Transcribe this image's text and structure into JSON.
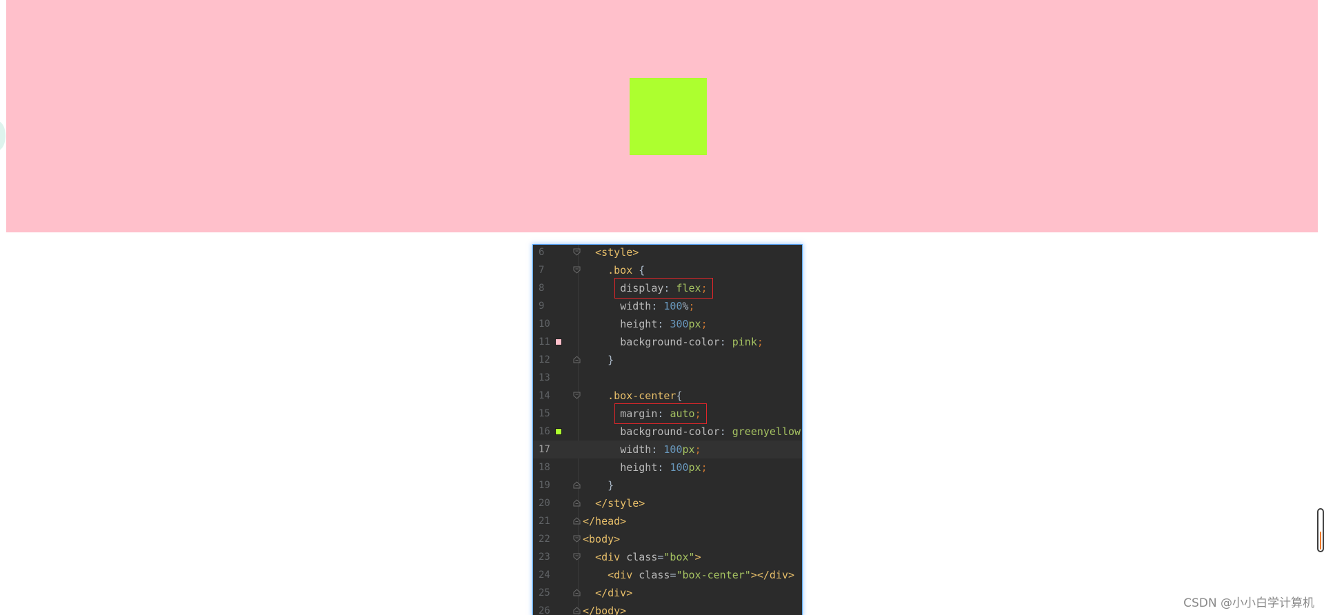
{
  "colors": {
    "box_background": "#ffc0cb",
    "box_center_background": "#adff2f",
    "editor_background": "#2b2b2b",
    "highlight_border": "#e0262a"
  },
  "editor": {
    "lines": [
      {
        "num": "6",
        "fold": "open",
        "swatch": null,
        "tokens": [
          [
            "plain",
            "  "
          ],
          [
            "tag",
            "<style>"
          ]
        ]
      },
      {
        "num": "7",
        "fold": "open",
        "swatch": null,
        "tokens": [
          [
            "plain",
            "    "
          ],
          [
            "sel",
            ".box"
          ],
          [
            "plain",
            " {"
          ]
        ]
      },
      {
        "num": "8",
        "fold": null,
        "swatch": null,
        "tokens": [
          [
            "plain",
            "      "
          ],
          [
            "prop",
            "display"
          ],
          [
            "plain",
            ": "
          ],
          [
            "val",
            "flex"
          ],
          [
            "semi",
            ";"
          ]
        ]
      },
      {
        "num": "9",
        "fold": null,
        "swatch": null,
        "tokens": [
          [
            "plain",
            "      "
          ],
          [
            "prop",
            "width"
          ],
          [
            "plain",
            ": "
          ],
          [
            "num",
            "100"
          ],
          [
            "plain",
            "%"
          ],
          [
            "semi",
            ";"
          ]
        ]
      },
      {
        "num": "10",
        "fold": null,
        "swatch": null,
        "tokens": [
          [
            "plain",
            "      "
          ],
          [
            "prop",
            "height"
          ],
          [
            "plain",
            ": "
          ],
          [
            "num",
            "300"
          ],
          [
            "val",
            "px"
          ],
          [
            "semi",
            ";"
          ]
        ]
      },
      {
        "num": "11",
        "fold": null,
        "swatch": "#ffc0cb",
        "tokens": [
          [
            "plain",
            "      "
          ],
          [
            "prop",
            "background-color"
          ],
          [
            "plain",
            ": "
          ],
          [
            "val",
            "pink"
          ],
          [
            "semi",
            ";"
          ]
        ]
      },
      {
        "num": "12",
        "fold": "close",
        "swatch": null,
        "tokens": [
          [
            "plain",
            "    }"
          ]
        ]
      },
      {
        "num": "13",
        "fold": null,
        "swatch": null,
        "tokens": [
          [
            "plain",
            ""
          ]
        ]
      },
      {
        "num": "14",
        "fold": "open",
        "swatch": null,
        "tokens": [
          [
            "plain",
            "    "
          ],
          [
            "sel",
            ".box-center"
          ],
          [
            "plain",
            "{"
          ]
        ]
      },
      {
        "num": "15",
        "fold": null,
        "swatch": null,
        "tokens": [
          [
            "plain",
            "      "
          ],
          [
            "prop",
            "margin"
          ],
          [
            "plain",
            ": "
          ],
          [
            "val",
            "auto"
          ],
          [
            "semi",
            ";"
          ]
        ]
      },
      {
        "num": "16",
        "fold": null,
        "swatch": "#adff2f",
        "tokens": [
          [
            "plain",
            "      "
          ],
          [
            "prop",
            "background-color"
          ],
          [
            "plain",
            ": "
          ],
          [
            "val",
            "greenyellow"
          ],
          [
            "semi",
            ";"
          ]
        ]
      },
      {
        "num": "17",
        "fold": null,
        "swatch": null,
        "current": true,
        "tokens": [
          [
            "plain",
            "      "
          ],
          [
            "prop",
            "width"
          ],
          [
            "plain",
            ": "
          ],
          [
            "num",
            "100"
          ],
          [
            "val",
            "px"
          ],
          [
            "semi",
            ";"
          ]
        ]
      },
      {
        "num": "18",
        "fold": null,
        "swatch": null,
        "tokens": [
          [
            "plain",
            "      "
          ],
          [
            "prop",
            "height"
          ],
          [
            "plain",
            ": "
          ],
          [
            "num",
            "100"
          ],
          [
            "val",
            "px"
          ],
          [
            "semi",
            ";"
          ]
        ]
      },
      {
        "num": "19",
        "fold": "close",
        "swatch": null,
        "tokens": [
          [
            "plain",
            "    }"
          ]
        ]
      },
      {
        "num": "20",
        "fold": "close",
        "swatch": null,
        "tokens": [
          [
            "plain",
            "  "
          ],
          [
            "tag",
            "</style>"
          ]
        ]
      },
      {
        "num": "21",
        "fold": "close",
        "swatch": null,
        "tokens": [
          [
            "tag",
            "</head>"
          ]
        ]
      },
      {
        "num": "22",
        "fold": "open",
        "swatch": null,
        "tokens": [
          [
            "tag",
            "<body>"
          ]
        ]
      },
      {
        "num": "23",
        "fold": "open",
        "swatch": null,
        "tokens": [
          [
            "plain",
            "  "
          ],
          [
            "tag",
            "<div "
          ],
          [
            "attr",
            "class"
          ],
          [
            "plain",
            "="
          ],
          [
            "str",
            "\"box\""
          ],
          [
            "tag",
            ">"
          ]
        ]
      },
      {
        "num": "24",
        "fold": null,
        "swatch": null,
        "tokens": [
          [
            "plain",
            "    "
          ],
          [
            "tag",
            "<div "
          ],
          [
            "attr",
            "class"
          ],
          [
            "plain",
            "="
          ],
          [
            "str",
            "\"box-center\""
          ],
          [
            "tag",
            "></div>"
          ]
        ]
      },
      {
        "num": "25",
        "fold": "close",
        "swatch": null,
        "tokens": [
          [
            "plain",
            "  "
          ],
          [
            "tag",
            "</div>"
          ]
        ]
      },
      {
        "num": "26",
        "fold": "close",
        "swatch": null,
        "tokens": [
          [
            "tag",
            "</body>"
          ]
        ]
      }
    ],
    "highlighted_lines": [
      "8",
      "15"
    ]
  },
  "watermark": "CSDN @小小白学计算机"
}
